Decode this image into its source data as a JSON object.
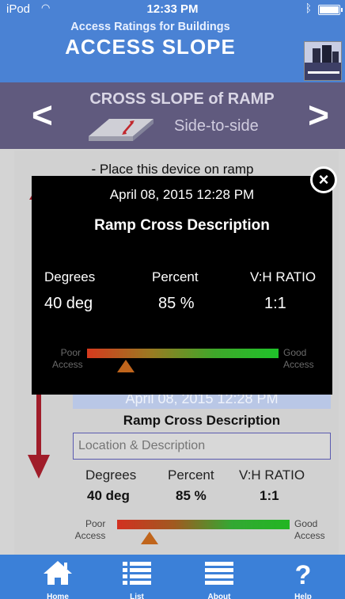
{
  "status_bar": {
    "carrier": "iPod",
    "time": "12:33 PM"
  },
  "header": {
    "subtitle": "Access Ratings for Buildings",
    "title": "ACCESS SLOPE"
  },
  "nav": {
    "title": "CROSS SLOPE of RAMP",
    "subtitle": "Side-to-side",
    "prev_glyph": "<",
    "next_glyph": ">"
  },
  "instruction": "- Place this device on ramp",
  "background_record": {
    "date": "April 08, 2015  12:28 PM",
    "description": "Ramp Cross Description",
    "location_placeholder": "Location & Description",
    "labels": {
      "degrees": "Degrees",
      "percent": "Percent",
      "ratio": "V:H RATIO"
    },
    "values": {
      "degrees": "40 deg",
      "percent": "85 %",
      "ratio": "1:1"
    },
    "poor_label": [
      "Poor",
      "Access"
    ],
    "good_label": [
      "Good",
      "Access"
    ]
  },
  "modal": {
    "date": "April 08, 2015  12:28 PM",
    "description": "Ramp Cross Description",
    "labels": {
      "degrees": "Degrees",
      "percent": "Percent",
      "ratio": "V:H RATIO"
    },
    "values": {
      "degrees": "40 deg",
      "percent": "85 %",
      "ratio": "1:1"
    },
    "poor_label": [
      "Poor",
      "Access"
    ],
    "good_label": [
      "Good",
      "Access"
    ],
    "close_glyph": "×"
  },
  "tabs": [
    {
      "label": "Home",
      "icon": "home-icon"
    },
    {
      "label": "List",
      "icon": "list-icon"
    },
    {
      "label": "About",
      "icon": "menu-icon"
    },
    {
      "label": "Help",
      "icon": "help-icon"
    }
  ],
  "colors": {
    "header_blue": "#4a82d4",
    "nav_purple": "#605a7e",
    "tabbar_blue": "#3b80d8",
    "arrow_red": "#a01d2a",
    "marker_orange": "#c0651c"
  }
}
